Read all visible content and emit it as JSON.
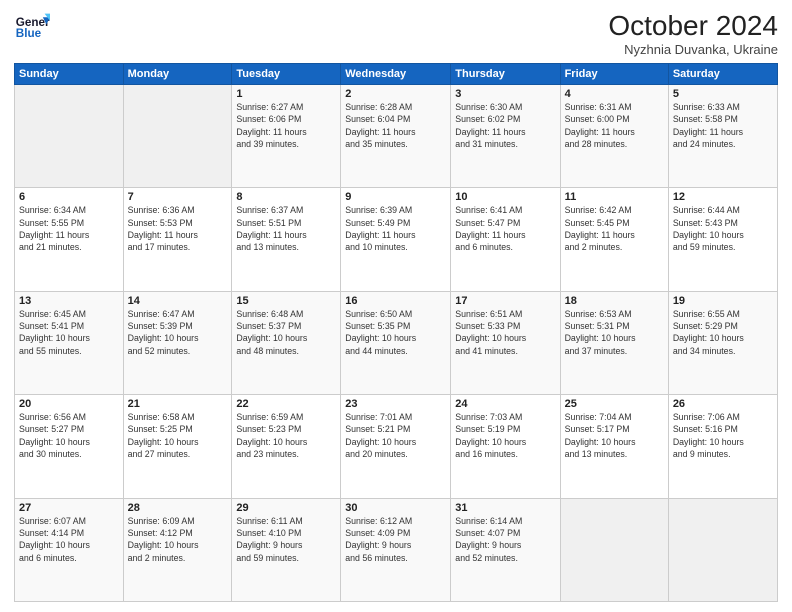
{
  "logo": {
    "line1": "General",
    "line2": "Blue"
  },
  "title": "October 2024",
  "subtitle": "Nyzhnia Duvanka, Ukraine",
  "days_of_week": [
    "Sunday",
    "Monday",
    "Tuesday",
    "Wednesday",
    "Thursday",
    "Friday",
    "Saturday"
  ],
  "weeks": [
    [
      {
        "day": "",
        "info": ""
      },
      {
        "day": "",
        "info": ""
      },
      {
        "day": "1",
        "info": "Sunrise: 6:27 AM\nSunset: 6:06 PM\nDaylight: 11 hours\nand 39 minutes."
      },
      {
        "day": "2",
        "info": "Sunrise: 6:28 AM\nSunset: 6:04 PM\nDaylight: 11 hours\nand 35 minutes."
      },
      {
        "day": "3",
        "info": "Sunrise: 6:30 AM\nSunset: 6:02 PM\nDaylight: 11 hours\nand 31 minutes."
      },
      {
        "day": "4",
        "info": "Sunrise: 6:31 AM\nSunset: 6:00 PM\nDaylight: 11 hours\nand 28 minutes."
      },
      {
        "day": "5",
        "info": "Sunrise: 6:33 AM\nSunset: 5:58 PM\nDaylight: 11 hours\nand 24 minutes."
      }
    ],
    [
      {
        "day": "6",
        "info": "Sunrise: 6:34 AM\nSunset: 5:55 PM\nDaylight: 11 hours\nand 21 minutes."
      },
      {
        "day": "7",
        "info": "Sunrise: 6:36 AM\nSunset: 5:53 PM\nDaylight: 11 hours\nand 17 minutes."
      },
      {
        "day": "8",
        "info": "Sunrise: 6:37 AM\nSunset: 5:51 PM\nDaylight: 11 hours\nand 13 minutes."
      },
      {
        "day": "9",
        "info": "Sunrise: 6:39 AM\nSunset: 5:49 PM\nDaylight: 11 hours\nand 10 minutes."
      },
      {
        "day": "10",
        "info": "Sunrise: 6:41 AM\nSunset: 5:47 PM\nDaylight: 11 hours\nand 6 minutes."
      },
      {
        "day": "11",
        "info": "Sunrise: 6:42 AM\nSunset: 5:45 PM\nDaylight: 11 hours\nand 2 minutes."
      },
      {
        "day": "12",
        "info": "Sunrise: 6:44 AM\nSunset: 5:43 PM\nDaylight: 10 hours\nand 59 minutes."
      }
    ],
    [
      {
        "day": "13",
        "info": "Sunrise: 6:45 AM\nSunset: 5:41 PM\nDaylight: 10 hours\nand 55 minutes."
      },
      {
        "day": "14",
        "info": "Sunrise: 6:47 AM\nSunset: 5:39 PM\nDaylight: 10 hours\nand 52 minutes."
      },
      {
        "day": "15",
        "info": "Sunrise: 6:48 AM\nSunset: 5:37 PM\nDaylight: 10 hours\nand 48 minutes."
      },
      {
        "day": "16",
        "info": "Sunrise: 6:50 AM\nSunset: 5:35 PM\nDaylight: 10 hours\nand 44 minutes."
      },
      {
        "day": "17",
        "info": "Sunrise: 6:51 AM\nSunset: 5:33 PM\nDaylight: 10 hours\nand 41 minutes."
      },
      {
        "day": "18",
        "info": "Sunrise: 6:53 AM\nSunset: 5:31 PM\nDaylight: 10 hours\nand 37 minutes."
      },
      {
        "day": "19",
        "info": "Sunrise: 6:55 AM\nSunset: 5:29 PM\nDaylight: 10 hours\nand 34 minutes."
      }
    ],
    [
      {
        "day": "20",
        "info": "Sunrise: 6:56 AM\nSunset: 5:27 PM\nDaylight: 10 hours\nand 30 minutes."
      },
      {
        "day": "21",
        "info": "Sunrise: 6:58 AM\nSunset: 5:25 PM\nDaylight: 10 hours\nand 27 minutes."
      },
      {
        "day": "22",
        "info": "Sunrise: 6:59 AM\nSunset: 5:23 PM\nDaylight: 10 hours\nand 23 minutes."
      },
      {
        "day": "23",
        "info": "Sunrise: 7:01 AM\nSunset: 5:21 PM\nDaylight: 10 hours\nand 20 minutes."
      },
      {
        "day": "24",
        "info": "Sunrise: 7:03 AM\nSunset: 5:19 PM\nDaylight: 10 hours\nand 16 minutes."
      },
      {
        "day": "25",
        "info": "Sunrise: 7:04 AM\nSunset: 5:17 PM\nDaylight: 10 hours\nand 13 minutes."
      },
      {
        "day": "26",
        "info": "Sunrise: 7:06 AM\nSunset: 5:16 PM\nDaylight: 10 hours\nand 9 minutes."
      }
    ],
    [
      {
        "day": "27",
        "info": "Sunrise: 6:07 AM\nSunset: 4:14 PM\nDaylight: 10 hours\nand 6 minutes."
      },
      {
        "day": "28",
        "info": "Sunrise: 6:09 AM\nSunset: 4:12 PM\nDaylight: 10 hours\nand 2 minutes."
      },
      {
        "day": "29",
        "info": "Sunrise: 6:11 AM\nSunset: 4:10 PM\nDaylight: 9 hours\nand 59 minutes."
      },
      {
        "day": "30",
        "info": "Sunrise: 6:12 AM\nSunset: 4:09 PM\nDaylight: 9 hours\nand 56 minutes."
      },
      {
        "day": "31",
        "info": "Sunrise: 6:14 AM\nSunset: 4:07 PM\nDaylight: 9 hours\nand 52 minutes."
      },
      {
        "day": "",
        "info": ""
      },
      {
        "day": "",
        "info": ""
      }
    ]
  ]
}
